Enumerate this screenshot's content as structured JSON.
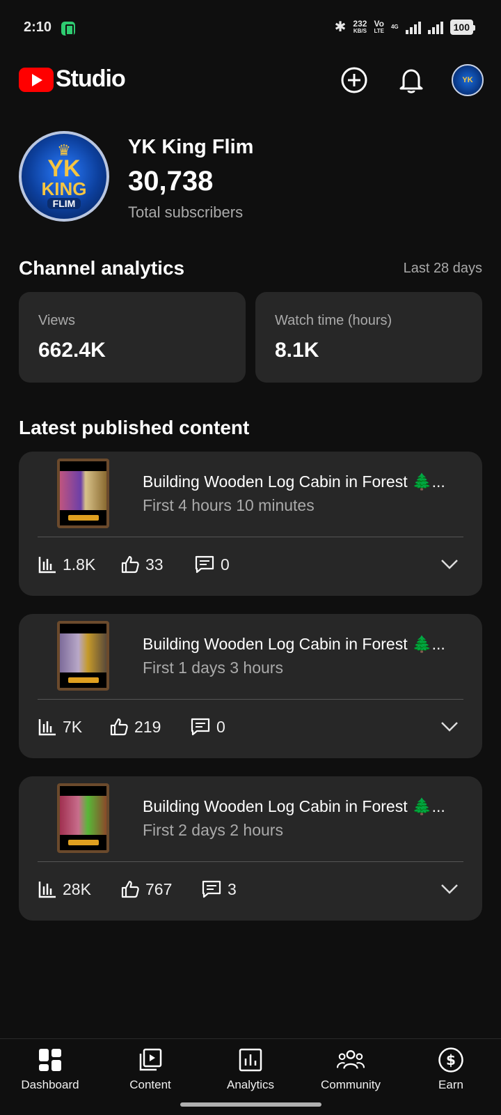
{
  "status_bar": {
    "time": "2:10",
    "speed_value": "232",
    "speed_unit": "KB/S",
    "volte_top": "Vo",
    "volte_bottom": "LTE",
    "network": "4G",
    "battery": "100"
  },
  "header": {
    "logo_text": "Studio"
  },
  "channel": {
    "name": "YK King Flim",
    "avatar_text_top": "YK",
    "avatar_text_mid": "KING",
    "avatar_text_bottom": "FLIM",
    "subscribers": "30,738",
    "subscribers_label": "Total subscribers"
  },
  "analytics": {
    "title": "Channel analytics",
    "range": "Last 28 days",
    "views_label": "Views",
    "views_value": "662.4K",
    "watch_label": "Watch time (hours)",
    "watch_value": "8.1K"
  },
  "latest": {
    "title": "Latest published content",
    "items": [
      {
        "title": "Building Wooden Log Cabin in Forest 🌲...",
        "age": "First 4 hours 10 minutes",
        "views": "1.8K",
        "likes": "33",
        "comments": "0"
      },
      {
        "title": "Building Wooden Log Cabin in Forest 🌲...",
        "age": "First 1 days 3 hours",
        "views": "7K",
        "likes": "219",
        "comments": "0"
      },
      {
        "title": "Building Wooden Log Cabin in Forest 🌲...",
        "age": "First 2 days 2 hours",
        "views": "28K",
        "likes": "767",
        "comments": "3"
      }
    ]
  },
  "nav": {
    "dashboard": "Dashboard",
    "content": "Content",
    "analytics": "Analytics",
    "community": "Community",
    "earn": "Earn"
  },
  "colors": {
    "background": "#0f0f0f",
    "card": "#272727",
    "brand_red": "#ff0000",
    "secondary_text": "#aaaaaa"
  }
}
